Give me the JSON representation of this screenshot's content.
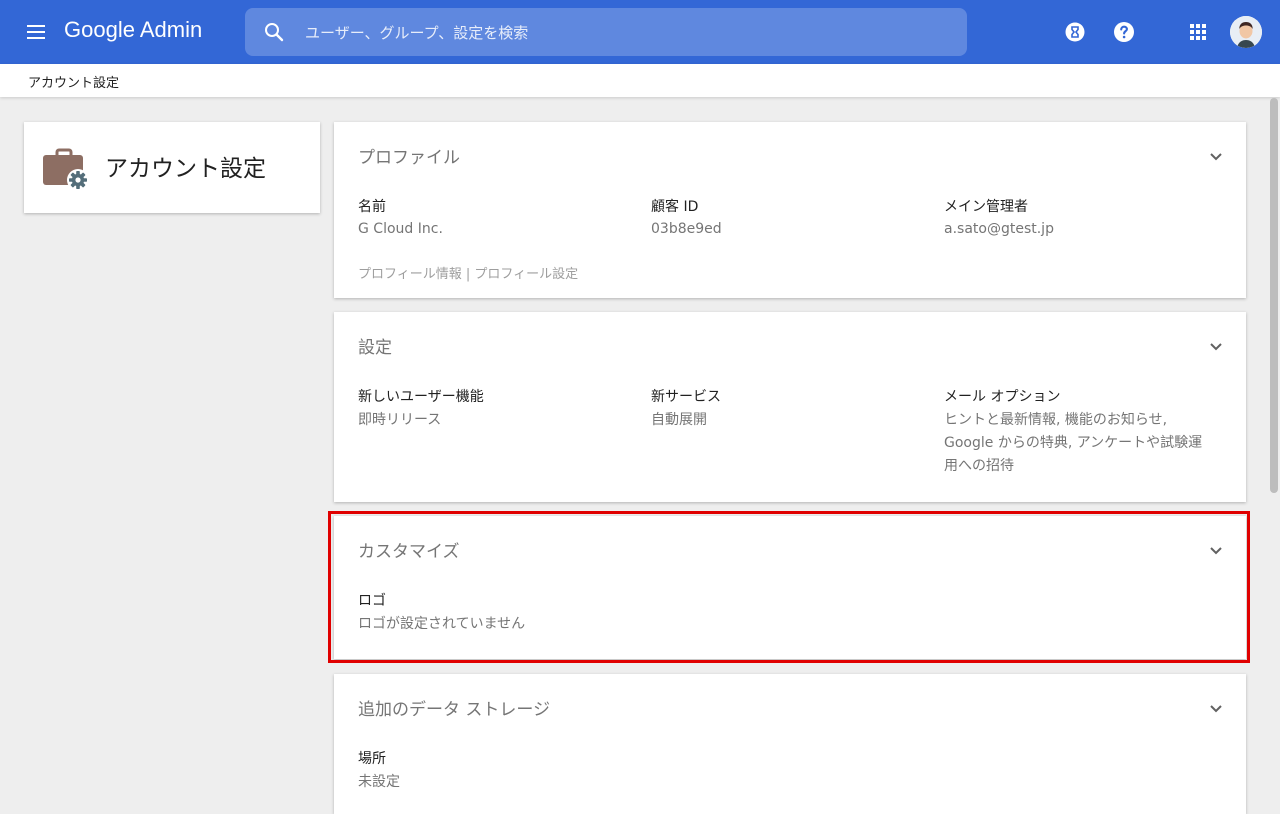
{
  "header": {
    "logo_text": "Google Admin",
    "search_placeholder": "ユーザー、グループ、設定を検索"
  },
  "breadcrumb": "アカウント設定",
  "left_card": {
    "title": "アカウント設定"
  },
  "cards": {
    "profile": {
      "title": "プロファイル",
      "fields": [
        {
          "label": "名前",
          "value": "G Cloud Inc."
        },
        {
          "label": "顧客 ID",
          "value": "03b8e9ed"
        },
        {
          "label": "メイン管理者",
          "value": "a.sato@gtest.jp"
        }
      ],
      "links": {
        "info": "プロフィール情報",
        "separator": " | ",
        "settings": "プロフィール設定"
      }
    },
    "settings": {
      "title": "設定",
      "fields": [
        {
          "label": "新しいユーザー機能",
          "value": "即時リリース"
        },
        {
          "label": "新サービス",
          "value": "自動展開"
        },
        {
          "label": "メール オプション",
          "value_lines": [
            "ヒントと最新情報, 機能のお知らせ,",
            "Google からの特典, アンケートや試験運",
            "用への招待"
          ]
        }
      ]
    },
    "customize": {
      "title": "カスタマイズ",
      "fields": [
        {
          "label": "ロゴ",
          "value": "ロゴが設定されていません"
        }
      ]
    },
    "storage": {
      "title": "追加のデータ ストレージ",
      "fields": [
        {
          "label": "場所",
          "value": "未設定"
        }
      ]
    }
  },
  "colors": {
    "topbar": "#3367d6",
    "highlight": "#e00000",
    "icon_brown": "#8d6e63",
    "gear": "#546e7a"
  },
  "icons": [
    "menu-icon",
    "search-icon",
    "hourglass-icon",
    "help-icon",
    "apps-grid-icon",
    "briefcase-gear-icon",
    "chevron-down-icon"
  ]
}
